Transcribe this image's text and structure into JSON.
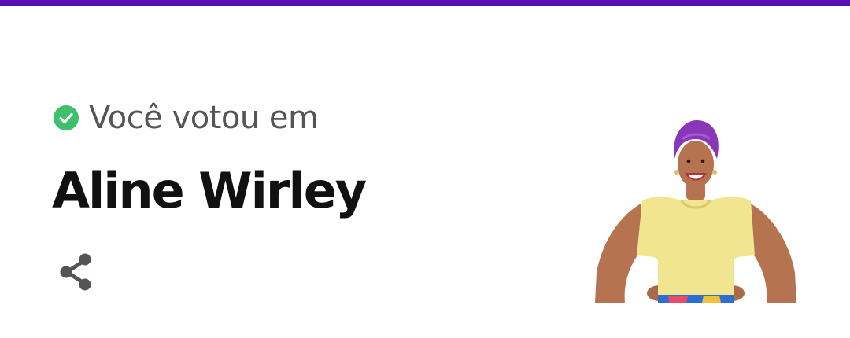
{
  "vote": {
    "status_text": "Você votou em",
    "candidate_name": "Aline Wirley",
    "status_icon": "check-circle-icon",
    "share_icon": "share-icon"
  },
  "colors": {
    "top_bar": "#5a0fb0",
    "check": "#3cc06a",
    "status_text": "#555555",
    "name_text": "#111111",
    "icon_gray": "#555555"
  }
}
